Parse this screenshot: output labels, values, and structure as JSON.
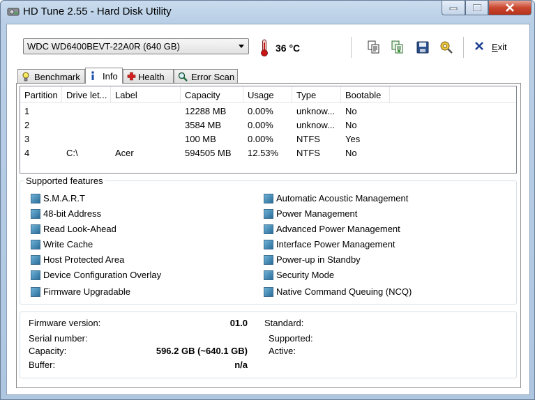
{
  "window": {
    "title": "HD Tune 2.55 - Hard Disk Utility"
  },
  "toolbar": {
    "drive": "WDC WD6400BEVT-22A0R (640 GB)",
    "temperature": "36 °C",
    "exit_prefix": "E",
    "exit_rest": "xit"
  },
  "tabs": [
    {
      "label": "Benchmark",
      "icon": "lightbulb-icon"
    },
    {
      "label": "Info",
      "icon": "info-icon"
    },
    {
      "label": "Health",
      "icon": "health-cross-icon"
    },
    {
      "label": "Error Scan",
      "icon": "magnifier-icon"
    }
  ],
  "partitions": {
    "columns": [
      "Partition",
      "Drive let...",
      "Label",
      "Capacity",
      "Usage",
      "Type",
      "Bootable"
    ],
    "rows": [
      [
        "1",
        "",
        "",
        "12288 MB",
        "0.00%",
        "unknow...",
        "No"
      ],
      [
        "2",
        "",
        "",
        "3584 MB",
        "0.00%",
        "unknow...",
        "No"
      ],
      [
        "3",
        "",
        "",
        "100 MB",
        "0.00%",
        "NTFS",
        "Yes"
      ],
      [
        "4",
        "C:\\",
        "Acer",
        "594505 MB",
        "12.53%",
        "NTFS",
        "No"
      ]
    ]
  },
  "features": {
    "title": "Supported features",
    "left": [
      "S.M.A.R.T",
      "48-bit Address",
      "Read Look-Ahead",
      "Write Cache",
      "Host Protected Area",
      "Device Configuration Overlay",
      "Firmware Upgradable"
    ],
    "right": [
      "Automatic Acoustic Management",
      "Power Management",
      "Advanced Power Management",
      "Interface Power Management",
      "Power-up in Standby",
      "Security Mode",
      "Native Command Queuing (NCQ)"
    ]
  },
  "info": {
    "firmware_label": "Firmware version:",
    "firmware_value": "01.0",
    "serial_label": "Serial number:",
    "serial_value": "",
    "capacity_label": "Capacity:",
    "capacity_value": "596.2 GB (~640.1 GB)",
    "buffer_label": "Buffer:",
    "buffer_value": "n/a",
    "standard_label": "Standard:",
    "supported_label": "Supported:",
    "active_label": "Active:"
  },
  "colors": {
    "checkbox": "#2a6d99",
    "close_button": "#c9472f",
    "title_bar": "#b9cfe6"
  }
}
